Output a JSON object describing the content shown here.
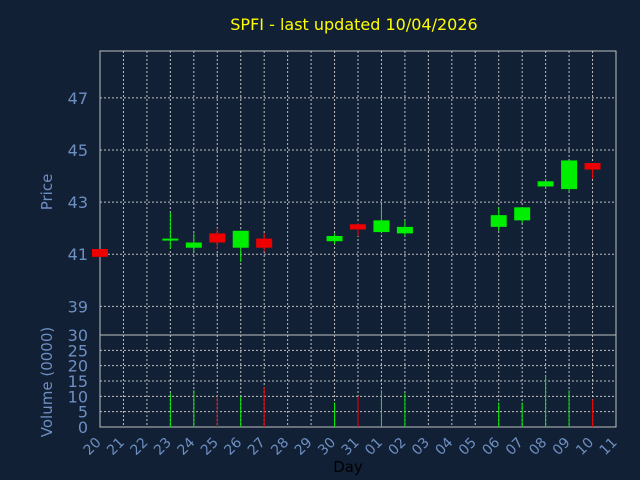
{
  "chart_data": {
    "type": "candlestick",
    "title": "SPFI - last updated 10/04/2026",
    "xlabel": "Day",
    "price_panel": {
      "ylabel": "Price",
      "yticks": [
        "39",
        "41",
        "43",
        "45",
        "47"
      ],
      "ylim": [
        37.9,
        48.8
      ],
      "grid": true
    },
    "volume_panel": {
      "ylabel": "Volume (0000)",
      "yticks": [
        "0",
        "5",
        "10",
        "15",
        "20",
        "25",
        "30"
      ],
      "ylim": [
        0,
        30
      ],
      "grid": true
    },
    "x_tick_labels": [
      "20",
      "21",
      "22",
      "23",
      "24",
      "25",
      "26",
      "27",
      "28",
      "29",
      "30",
      "31",
      "01",
      "02",
      "03",
      "04",
      "05",
      "06",
      "07",
      "08",
      "09",
      "10",
      "11"
    ],
    "candles": [
      {
        "day": "20",
        "open": 41.2,
        "high": 41.2,
        "low": 40.9,
        "close": 40.9,
        "volume": 0
      },
      {
        "day": "23",
        "open": 41.55,
        "high": 42.6,
        "low": 41.2,
        "close": 41.6,
        "volume": 11
      },
      {
        "day": "24",
        "open": 41.25,
        "high": 41.8,
        "low": 41.1,
        "close": 41.45,
        "volume": 12
      },
      {
        "day": "25",
        "open": 41.8,
        "high": 42.0,
        "low": 41.2,
        "close": 41.45,
        "volume": 10
      },
      {
        "day": "26",
        "open": 41.25,
        "high": 41.9,
        "low": 40.7,
        "close": 41.9,
        "volume": 10
      },
      {
        "day": "27",
        "open": 41.6,
        "high": 41.8,
        "low": 41.1,
        "close": 41.25,
        "volume": 13
      },
      {
        "day": "30",
        "open": 41.5,
        "high": 41.8,
        "low": 41.4,
        "close": 41.7,
        "volume": 8
      },
      {
        "day": "31",
        "open": 42.15,
        "high": 42.2,
        "low": 41.7,
        "close": 41.95,
        "volume": 10
      },
      {
        "day": "01",
        "open": 41.85,
        "high": 42.9,
        "low": 41.8,
        "close": 42.3,
        "volume": 12
      },
      {
        "day": "02",
        "open": 41.8,
        "high": 42.3,
        "low": 41.7,
        "close": 42.05,
        "volume": 11
      },
      {
        "day": "06",
        "open": 42.05,
        "high": 42.8,
        "low": 41.9,
        "close": 42.5,
        "volume": 8
      },
      {
        "day": "07",
        "open": 42.3,
        "high": 42.8,
        "low": 42.2,
        "close": 42.8,
        "volume": 8
      },
      {
        "day": "08",
        "open": 43.6,
        "high": 43.9,
        "low": 43.5,
        "close": 43.8,
        "volume": 17
      },
      {
        "day": "09",
        "open": 43.5,
        "high": 44.6,
        "low": 43.4,
        "close": 44.6,
        "volume": 12
      },
      {
        "day": "10",
        "open": 44.5,
        "high": 44.5,
        "low": 43.9,
        "close": 44.25,
        "volume": 9
      }
    ]
  },
  "colors": {
    "background": "#112035",
    "grid": "#c0c0c0",
    "axis_text": "#6e8fc2",
    "title": "#ffff00",
    "up": "#00ee00",
    "down": "#ee0000"
  }
}
